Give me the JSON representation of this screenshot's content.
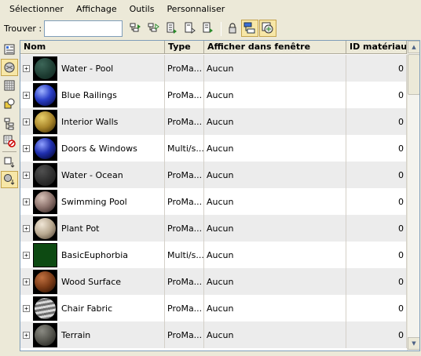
{
  "menu": {
    "items": [
      "Sélectionner",
      "Affichage",
      "Outils",
      "Personnaliser"
    ]
  },
  "find": {
    "label": "Trouver :",
    "value": ""
  },
  "toolbar": {
    "icons": [
      "select-all-icon",
      "select-none-icon",
      "invert-selection-icon",
      "select-children-icon",
      "select-dependents-icon",
      "lock-icon",
      "display-children-icon",
      "sync-selection-icon"
    ]
  },
  "left_toolbar": {
    "icons": [
      "display-geometry-icon",
      "display-materials-icon",
      "display-maps-icon",
      "display-objects-icon",
      "hierarchy-icon",
      "no-material-icon",
      "sort-by-object-icon",
      "sort-by-material-icon"
    ]
  },
  "table": {
    "columns": [
      "Nom",
      "Type",
      "Afficher dans fenêtre",
      "ID matériau"
    ],
    "rows": [
      {
        "name": "Water - Pool",
        "type": "ProMa...",
        "display": "Aucun",
        "id": "0",
        "swatch": "water-pool"
      },
      {
        "name": "Blue Railings",
        "type": "ProMa...",
        "display": "Aucun",
        "id": "0",
        "swatch": "blue-railings"
      },
      {
        "name": "Interior Walls",
        "type": "ProMa...",
        "display": "Aucun",
        "id": "0",
        "swatch": "interior-walls"
      },
      {
        "name": "Doors & Windows",
        "type": "Multi/s...",
        "display": "Aucun",
        "id": "0",
        "swatch": "doors-windows"
      },
      {
        "name": "Water - Ocean",
        "type": "ProMa...",
        "display": "Aucun",
        "id": "0",
        "swatch": "water-ocean"
      },
      {
        "name": "Swimming Pool",
        "type": "ProMa...",
        "display": "Aucun",
        "id": "0",
        "swatch": "swimming-pool"
      },
      {
        "name": "Plant Pot",
        "type": "ProMa...",
        "display": "Aucun",
        "id": "0",
        "swatch": "plant-pot"
      },
      {
        "name": "BasicEuphorbia",
        "type": "Multi/s...",
        "display": "Aucun",
        "id": "0",
        "swatch": "basic-euphorbia"
      },
      {
        "name": "Wood Surface",
        "type": "ProMa...",
        "display": "Aucun",
        "id": "0",
        "swatch": "wood-surface"
      },
      {
        "name": "Chair Fabric",
        "type": "ProMa...",
        "display": "Aucun",
        "id": "0",
        "swatch": "chair-fabric"
      },
      {
        "name": "Terrain",
        "type": "ProMa...",
        "display": "Aucun",
        "id": "0",
        "swatch": "terrain"
      }
    ]
  },
  "colors": {
    "window_bg": "#ece9d8",
    "active_button": "#f7e7a7",
    "row_alt": "#ececec",
    "border": "#7f9db9"
  }
}
